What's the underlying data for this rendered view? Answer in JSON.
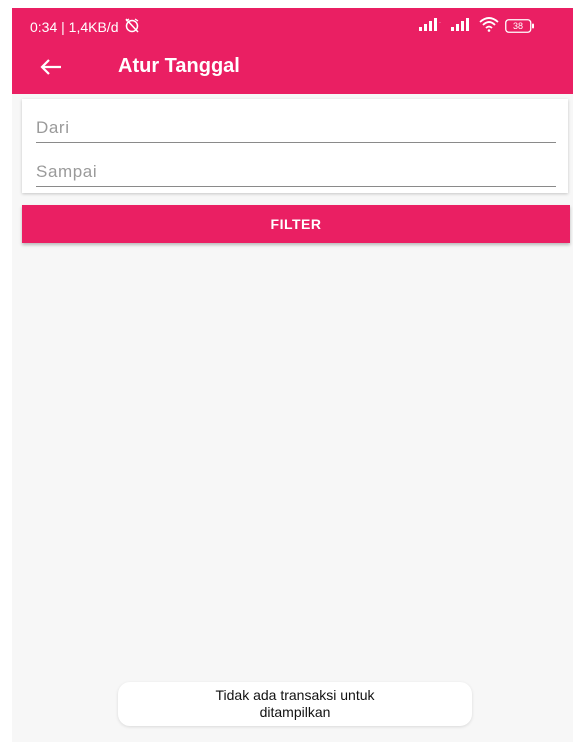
{
  "status_bar": {
    "time_speed": "0:34 | 1,4KB/d",
    "battery_level": "38"
  },
  "app_bar": {
    "title": "Atur Tanggal"
  },
  "form": {
    "from_placeholder": "Dari",
    "to_placeholder": "Sampai",
    "from_value": "",
    "to_value": ""
  },
  "filter_button": {
    "label": "FILTER"
  },
  "toast": {
    "line1": "Tidak ada transaksi untuk",
    "line2": "ditampilkan"
  },
  "colors": {
    "primary": "#ea1f63",
    "background": "#f7f7f7"
  },
  "icons": {
    "back": "arrow-left-icon",
    "mute": "alarm-off-icon",
    "signal": "cellular-signal-icon",
    "wifi": "wifi-icon",
    "battery": "battery-icon"
  }
}
